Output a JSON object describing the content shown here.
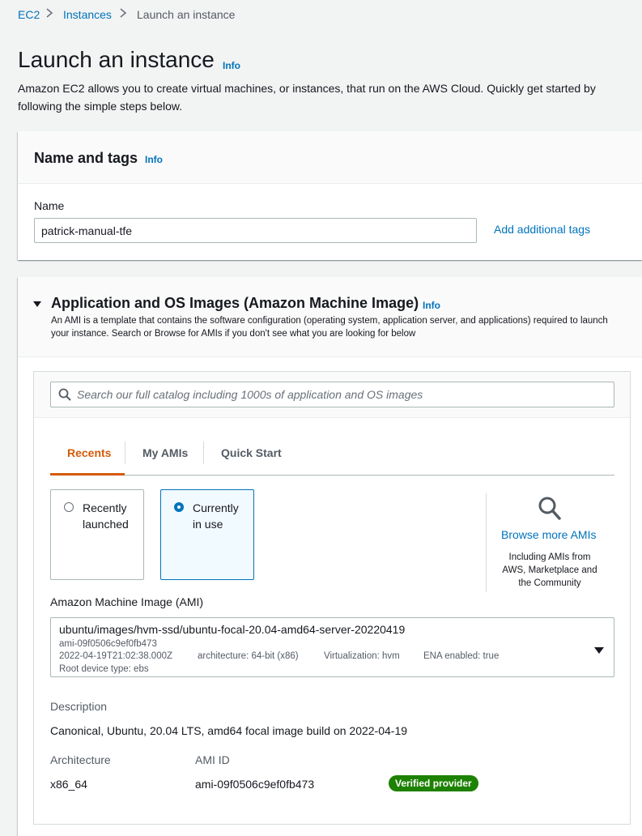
{
  "breadcrumb": {
    "items": [
      "EC2",
      "Instances",
      "Launch an instance"
    ]
  },
  "page": {
    "title": "Launch an instance",
    "info": "Info",
    "description": "Amazon EC2 allows you to create virtual machines, or instances, that run on the AWS Cloud. Quickly get started by following the simple steps below."
  },
  "name_tags": {
    "title": "Name and tags",
    "info": "Info",
    "name_label": "Name",
    "name_value": "patrick-manual-tfe",
    "add_tags": "Add additional tags"
  },
  "ami_section": {
    "title": "Application and OS Images (Amazon Machine Image)",
    "info": "Info",
    "description": "An AMI is a template that contains the software configuration (operating system, application server, and applications) required to launch your instance. Search or Browse for AMIs if you don't see what you are looking for below",
    "search_placeholder": "Search our full catalog including 1000s of application and OS images",
    "tabs": [
      "Recents",
      "My AMIs",
      "Quick Start"
    ],
    "active_tab": "Recents",
    "options": [
      {
        "line1": "Recently",
        "line2": "launched",
        "selected": false
      },
      {
        "line1": "Currently",
        "line2": "in use",
        "selected": true
      }
    ],
    "browse_more": "Browse more AMIs",
    "browse_note": [
      "Including AMIs from",
      "AWS, Marketplace and",
      "the Community"
    ],
    "ami_label": "Amazon Machine Image (AMI)",
    "ami_select": {
      "name": "ubuntu/images/hvm-ssd/ubuntu-focal-20.04-amd64-server-20220419",
      "id": "ami-09f0506c9ef0fb473",
      "date": "2022-04-19T21:02:38.000Z",
      "architecture": "architecture: 64-bit (x86)",
      "virtualization": "Virtualization: hvm",
      "ena": "ENA enabled: true",
      "root_device": "Root device type: ebs"
    },
    "description_label": "Description",
    "description_value": "Canonical, Ubuntu, 20.04 LTS, amd64 focal image build on 2022-04-19",
    "architecture_label": "Architecture",
    "architecture_value": "x86_64",
    "ami_id_label": "AMI ID",
    "ami_id_value": "ami-09f0506c9ef0fb473",
    "verified_badge": "Verified provider"
  },
  "colors": {
    "link": "#0073bb",
    "active_tab": "#d45b07",
    "badge": "#1d8102"
  }
}
